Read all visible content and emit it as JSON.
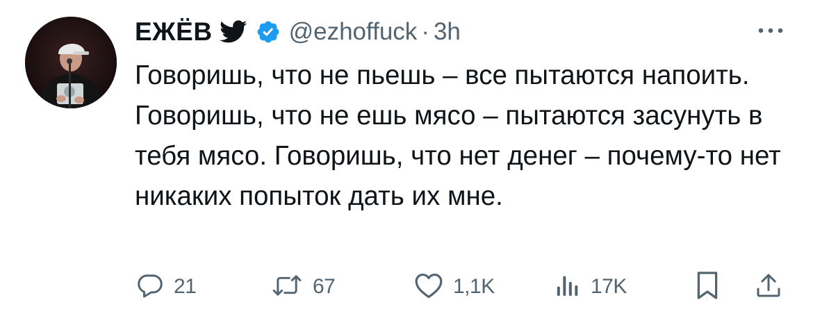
{
  "tweet": {
    "author": {
      "display_name": "ЕЖЁВ",
      "handle": "@ezhoffuck",
      "dot": "·",
      "time": "3h"
    },
    "icons": {
      "bird": "twitter-bird-icon",
      "verified": "verified-badge-icon",
      "more": "more-dots-icon"
    },
    "text": "Говоришь, что не пьешь – все пытаются напоить. Говоришь, что не ешь мясо – пытаются засунуть в тебя мясо. Говоришь, что нет денег – почему-то нет никаких попыток дать их мне.",
    "actions": {
      "reply": {
        "icon": "reply-icon",
        "count": "21"
      },
      "retweet": {
        "icon": "retweet-icon",
        "count": "67"
      },
      "like": {
        "icon": "heart-icon",
        "count": "1,1K"
      },
      "views": {
        "icon": "views-icon",
        "count": "17K"
      },
      "bookmark": {
        "icon": "bookmark-icon"
      },
      "share": {
        "icon": "share-icon"
      }
    },
    "colors": {
      "text": "#0f1419",
      "secondary": "#536471",
      "verified": "#1d9bf0",
      "background": "#ffffff"
    }
  }
}
